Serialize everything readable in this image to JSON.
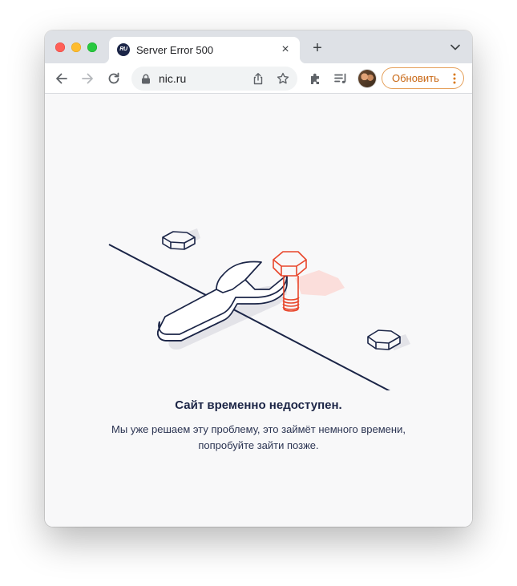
{
  "tab": {
    "favicon_text": "RU",
    "title": "Server Error 500",
    "close_glyph": "×",
    "new_tab_glyph": "+"
  },
  "omnibox": {
    "url": "nic.ru"
  },
  "toolbar": {
    "update_label": "Обновить"
  },
  "error": {
    "title": "Сайт временно недоступен.",
    "line1": "Мы уже решаем эту проблему, это займёт немного времени,",
    "line2": "попробуйте зайти позже."
  },
  "colors": {
    "accent_orange": "#e06a0e",
    "illustration_navy": "#1b2547",
    "illustration_red": "#e8462b"
  },
  "icons": [
    "back-icon",
    "forward-icon",
    "reload-icon",
    "lock-icon",
    "share-icon",
    "bookmark-star-icon",
    "extensions-icon",
    "media-icon",
    "menu-dots-icon",
    "tab-search-icon"
  ]
}
